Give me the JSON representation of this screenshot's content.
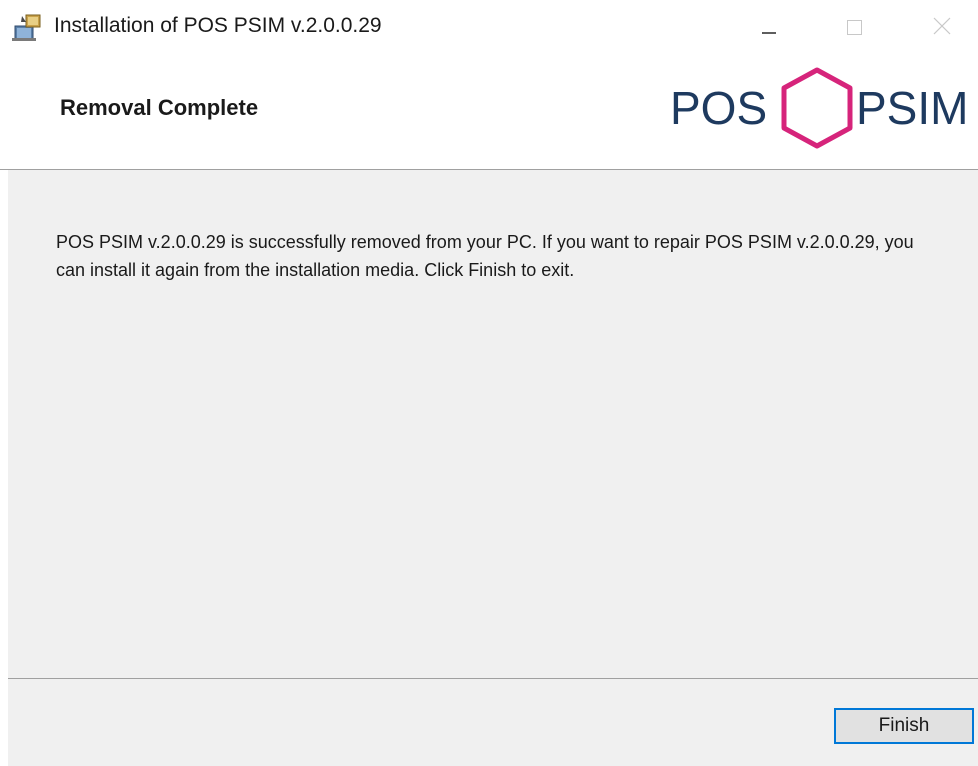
{
  "window": {
    "title": "Installation of POS PSIM v.2.0.0.29",
    "controls": {
      "minimize": "minimize-icon",
      "maximize": "maximize-icon",
      "close": "close-icon"
    }
  },
  "header": {
    "title": "Removal Complete",
    "logo": {
      "left_text": "POS",
      "right_text": "PSIM",
      "accent_color": "#d6247b",
      "text_color": "#1e3a5f"
    }
  },
  "body": {
    "message": "POS PSIM v.2.0.0.29 is successfully removed from your PC. If you want to repair POS PSIM v.2.0.0.29, you can install it again from the installation media. Click Finish to exit."
  },
  "footer": {
    "finish_label": "Finish",
    "finish_border_color": "#0078d7"
  }
}
